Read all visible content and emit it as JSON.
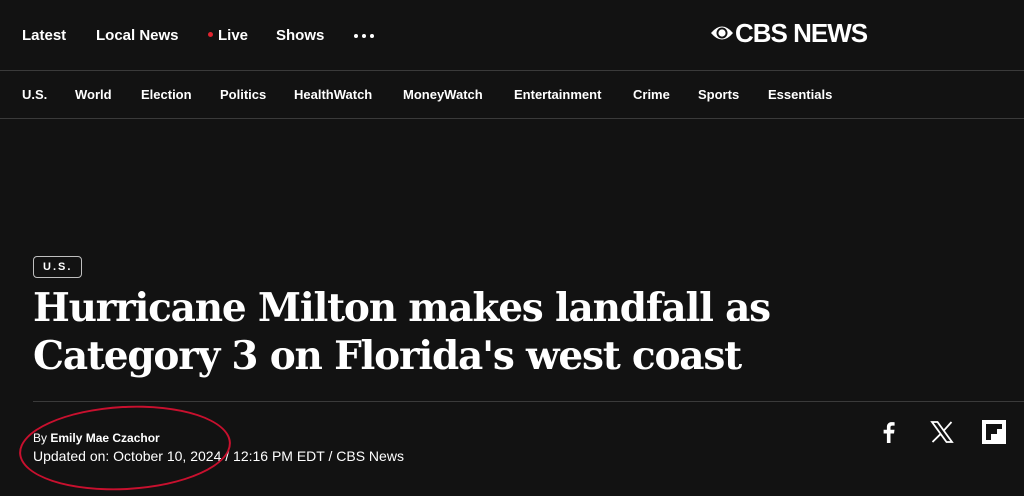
{
  "topnav": {
    "items": [
      "Latest",
      "Local News",
      "Live",
      "Shows"
    ],
    "more_icon": "more-dots-icon",
    "live_dot_color": "#e0242f"
  },
  "logo": {
    "text": "CBS NEWS"
  },
  "section_nav": {
    "items": [
      "U.S.",
      "World",
      "Election",
      "Politics",
      "HealthWatch",
      "MoneyWatch",
      "Entertainment",
      "Crime",
      "Sports",
      "Essentials"
    ]
  },
  "article": {
    "tag": "U.S.",
    "headline_line1": "Hurricane Milton makes landfall as",
    "headline_line2": "Category 3 on Florida's west coast",
    "by_prefix": "By",
    "author": "Emily Mae Czachor",
    "updated": "Updated on: October 10, 2024 / 12:16 PM EDT / CBS News"
  },
  "share": {
    "icons": [
      "facebook-icon",
      "x-icon",
      "flipboard-icon"
    ]
  },
  "colors": {
    "background": "#121212",
    "annotation_circle": "#c8102e"
  }
}
